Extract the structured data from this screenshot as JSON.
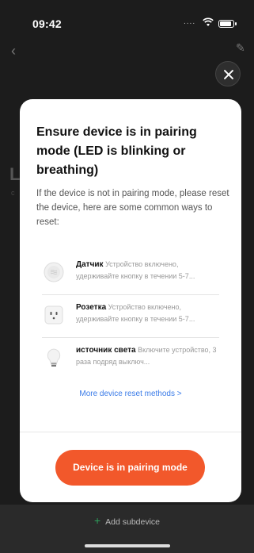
{
  "status_bar": {
    "time": "09:42",
    "signal": "...."
  },
  "background": {
    "back_icon": "chevron-left",
    "edit_icon": "pencil",
    "title_fragment": "L",
    "subtitle_fragment": "c"
  },
  "modal": {
    "title": "Ensure device is in pairing mode (LED is blinking or breathing)",
    "description": "If the device is not in pairing mode, please reset the device, here are some common ways to reset:",
    "devices": [
      {
        "name": "Датчик",
        "desc": "Устройство включено, удерживайте кнопку в течении 5-7...",
        "icon": "sensor-icon"
      },
      {
        "name": "Розетка",
        "desc": "Устройство включено, удерживайте кнопку в течении 5-7...",
        "icon": "socket-icon"
      },
      {
        "name": "источник света",
        "desc": "Включите устройство, 3 раза подряд выключ...",
        "icon": "bulb-icon"
      }
    ],
    "more_link": "More device reset methods >",
    "confirm_button": "Device is in pairing mode"
  },
  "bottom": {
    "add_subdevice": "Add subdevice"
  },
  "colors": {
    "accent": "#f2582b",
    "link": "#3a7be8",
    "add_icon": "#2d9e5b"
  }
}
